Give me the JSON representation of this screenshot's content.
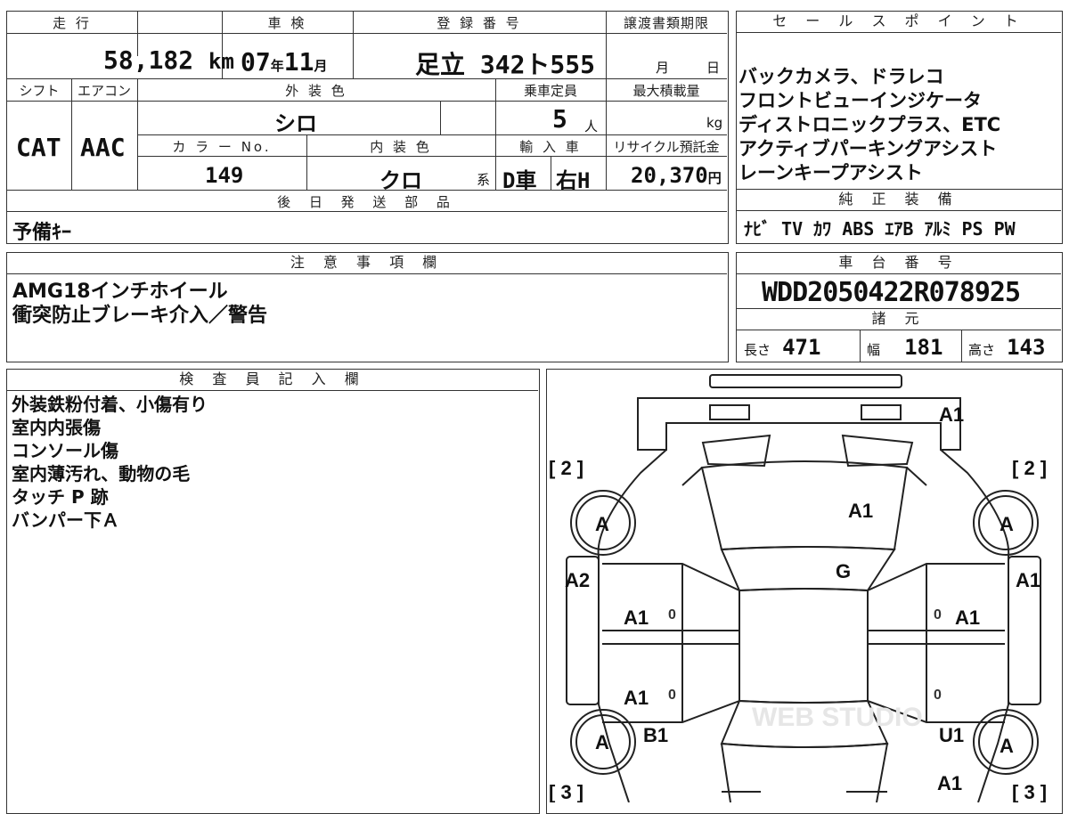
{
  "top": {
    "mileage_label": "走 行",
    "mileage_value": "58,182",
    "mileage_unit": "km",
    "inspection_label": "車 検",
    "inspection_year": "07",
    "inspection_year_unit": "年",
    "inspection_month": "11",
    "inspection_month_unit": "月",
    "reg_label": "登 録 番 号",
    "reg_value": "足立 342ト555",
    "transfer_label": "譲渡書類期限",
    "transfer_month_unit": "月",
    "transfer_day_unit": "日",
    "shift_label": "シフト",
    "shift_value": "CAT",
    "ac_label": "エアコン",
    "ac_value": "AAC",
    "exterior_label": "外 装 色",
    "exterior_value": "シロ",
    "capacity_label": "乗車定員",
    "capacity_value": "5",
    "capacity_unit": "人",
    "load_label": "最大積載量",
    "load_unit": "kg",
    "color_no_label": "カ ラ ー No.",
    "color_no_value": "149",
    "interior_label": "内 装 色",
    "interior_value": "クロ",
    "interior_unit": "系",
    "import_label": "輸 入 車",
    "import_d": "D車",
    "import_h": "右H",
    "recycle_label": "リサイクル預託金",
    "recycle_value": "20,370",
    "recycle_unit": "円"
  },
  "sales": {
    "label": "セ ー ル ス ポ イ ン ト",
    "lines": [
      "バックカメラ、ドラレコ",
      "フロントビューインジケータ",
      "ディストロニックプラス、ETC",
      "アクティブパーキングアシスト",
      "レーンキープアシスト"
    ]
  },
  "later_parts": {
    "label": "後 日 発 送 部 品",
    "value": "予備ｷｰ"
  },
  "genuine": {
    "label": "純 正 装 備",
    "value": "ﾅﾋﾞ TV ｶﾜ ABS ｴｱB ｱﾙﾐ PS PW"
  },
  "notes": {
    "label": "注 意 事 項 欄",
    "lines": [
      "AMG18インチホイール",
      "衝突防止ブレーキ介入／警告"
    ]
  },
  "chassis": {
    "label": "車 台 番 号",
    "value": "WDD2050422R078925"
  },
  "specs": {
    "label": "諸 元",
    "length_label": "長さ",
    "length_value": "471",
    "width_label": "幅",
    "width_value": "181",
    "height_label": "高さ",
    "height_value": "143"
  },
  "inspector": {
    "label": "検 査 員 記 入 欄",
    "lines": [
      "外装鉄粉付着、小傷有り",
      "室内内張傷",
      "コンソール傷",
      "室内薄汚れ、動物の毛",
      "タッチ P 跡",
      "バンパー下Ａ"
    ]
  },
  "diagram": {
    "marks": {
      "front": "A1",
      "hood": "A1",
      "glass": "G",
      "left_fender": "A2",
      "right_fender": "A1",
      "left_front_door": "A1",
      "right_front_door": "A1",
      "left_rear_door": "A1",
      "left_rear_fender": "B1",
      "right_rear_fender": "U1",
      "rear_right": "A1",
      "tire_fl": "A",
      "tire_fr": "A",
      "tire_rl": "A",
      "tire_rr": "A",
      "zero": "0"
    },
    "brackets": {
      "tl": "[ 2 ]",
      "tr": "[ 2 ]",
      "bl": "[ 3 ]",
      "br": "[ 3 ]"
    },
    "watermark": "WEB STUDIO"
  }
}
